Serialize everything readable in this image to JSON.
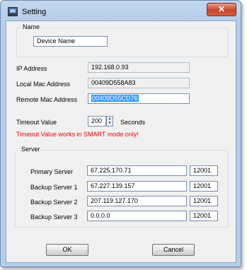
{
  "window": {
    "title": "Setting",
    "close_glyph": "✕"
  },
  "name_group": {
    "label": "Name",
    "device_name": "Device Name"
  },
  "ip": {
    "label": "IP Address",
    "value": "192.168.0.93"
  },
  "local_mac": {
    "label": "Local Mac Address",
    "value": "00409D558A83"
  },
  "remote_mac": {
    "label": "Remote Mac Address",
    "value": "00409D55CD76"
  },
  "timeout": {
    "label": "Timeout Value",
    "value": "200",
    "unit": "Seconds",
    "warning": "Timeout Value works in SMART mode only!"
  },
  "server_group": {
    "label": "Server",
    "rows": [
      {
        "label": "Primary Server",
        "ip": "67.225.170.71",
        "port": "12001"
      },
      {
        "label": "Backup Server 1",
        "ip": "67.227.139.157",
        "port": "12001"
      },
      {
        "label": "Backup Server 2",
        "ip": "207.119.127.170",
        "port": "12001"
      },
      {
        "label": "Backup Server 3",
        "ip": "0.0.0.0",
        "port": "12001"
      }
    ]
  },
  "buttons": {
    "ok": "OK",
    "cancel": "Cancel"
  },
  "colors": {
    "warning": "#ff0000",
    "selection": "#3399ff"
  },
  "icons": {
    "app": "app-window-icon",
    "close": "close-icon",
    "spin_up": "spin-up-icon",
    "spin_down": "spin-down-icon"
  }
}
